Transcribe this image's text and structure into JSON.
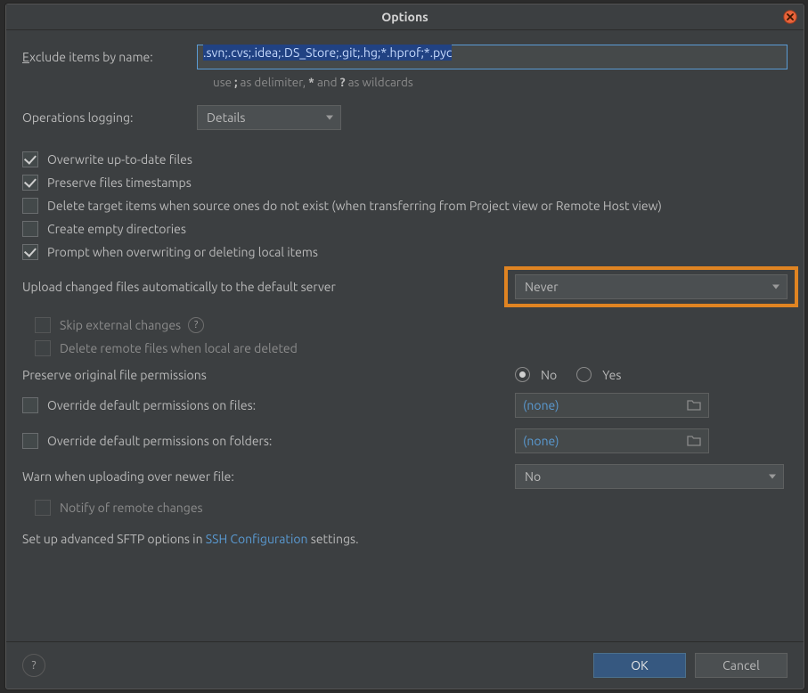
{
  "title": "Options",
  "exclude": {
    "label": "Exclude items by name:",
    "value": ".svn;.cvs;.idea;.DS_Store;.git;.hg;*.hprof;*.pyc",
    "hint_prefix": "use ",
    "hint_sep": ";",
    "hint_mid": " as delimiter, ",
    "hint_star": "*",
    "hint_and": " and ",
    "hint_q": "?",
    "hint_suffix": " as wildcards"
  },
  "logging": {
    "label": "Operations logging:",
    "value": "Details"
  },
  "checks": {
    "overwrite": "Overwrite up-to-date files",
    "preserve_ts": "Preserve files timestamps",
    "delete_target": "Delete target items when source ones do not exist (when transferring from Project view or Remote Host view)",
    "create_empty": "Create empty directories",
    "prompt_overwrite": "Prompt when overwriting or deleting local items",
    "skip_external": "Skip external changes",
    "delete_remote": "Delete remote files when local are deleted",
    "notify_remote": "Notify of remote changes"
  },
  "upload": {
    "label": "Upload changed files automatically to the default server",
    "value": "Never"
  },
  "perms": {
    "preserve_label": "Preserve original file permissions",
    "radio_no": "No",
    "radio_yes": "Yes",
    "override_files": "Override default permissions on files:",
    "override_folders": "Override default permissions on folders:",
    "none": "(none)"
  },
  "warn": {
    "label": "Warn when uploading over newer file:",
    "value": "No"
  },
  "advanced": {
    "prefix": "Set up advanced SFTP options in ",
    "link": "SSH Configuration",
    "suffix": " settings."
  },
  "buttons": {
    "ok": "OK",
    "cancel": "Cancel"
  }
}
